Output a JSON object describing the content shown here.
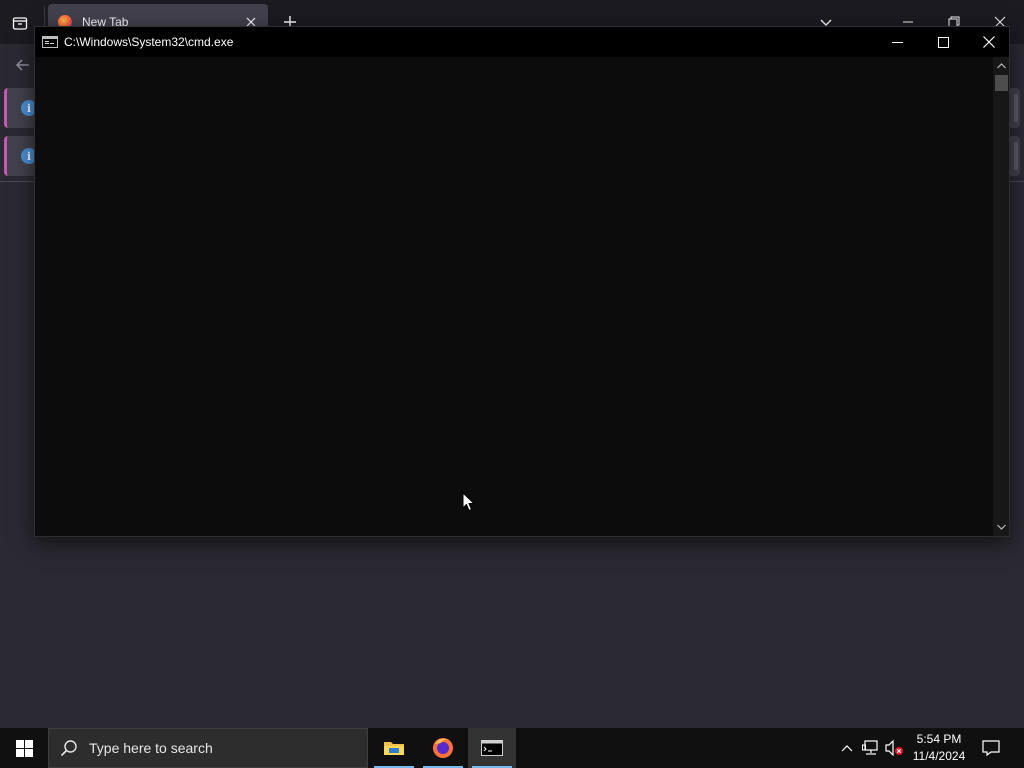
{
  "firefox": {
    "tab": {
      "title": "New Tab"
    },
    "notifications": [
      {
        "icon": "info-icon"
      },
      {
        "icon": "info-icon"
      }
    ]
  },
  "cmd": {
    "title": "C:\\Windows\\System32\\cmd.exe",
    "output": ""
  },
  "taskbar": {
    "search_placeholder": "Type here to search",
    "apps": [
      {
        "name": "File Explorer",
        "icon": "folder-icon",
        "running": true,
        "active": false
      },
      {
        "name": "Firefox",
        "icon": "firefox-icon",
        "running": true,
        "active": false
      },
      {
        "name": "Command Prompt",
        "icon": "cmd-icon",
        "running": true,
        "active": true
      }
    ],
    "clock": {
      "time": "5:54 PM",
      "date": "11/4/2024"
    }
  },
  "colors": {
    "console_bg": "#0c0c0c",
    "firefox_bg": "#2b2a33",
    "taskbar_bg": "#101010",
    "accent": "#76b9ed"
  }
}
